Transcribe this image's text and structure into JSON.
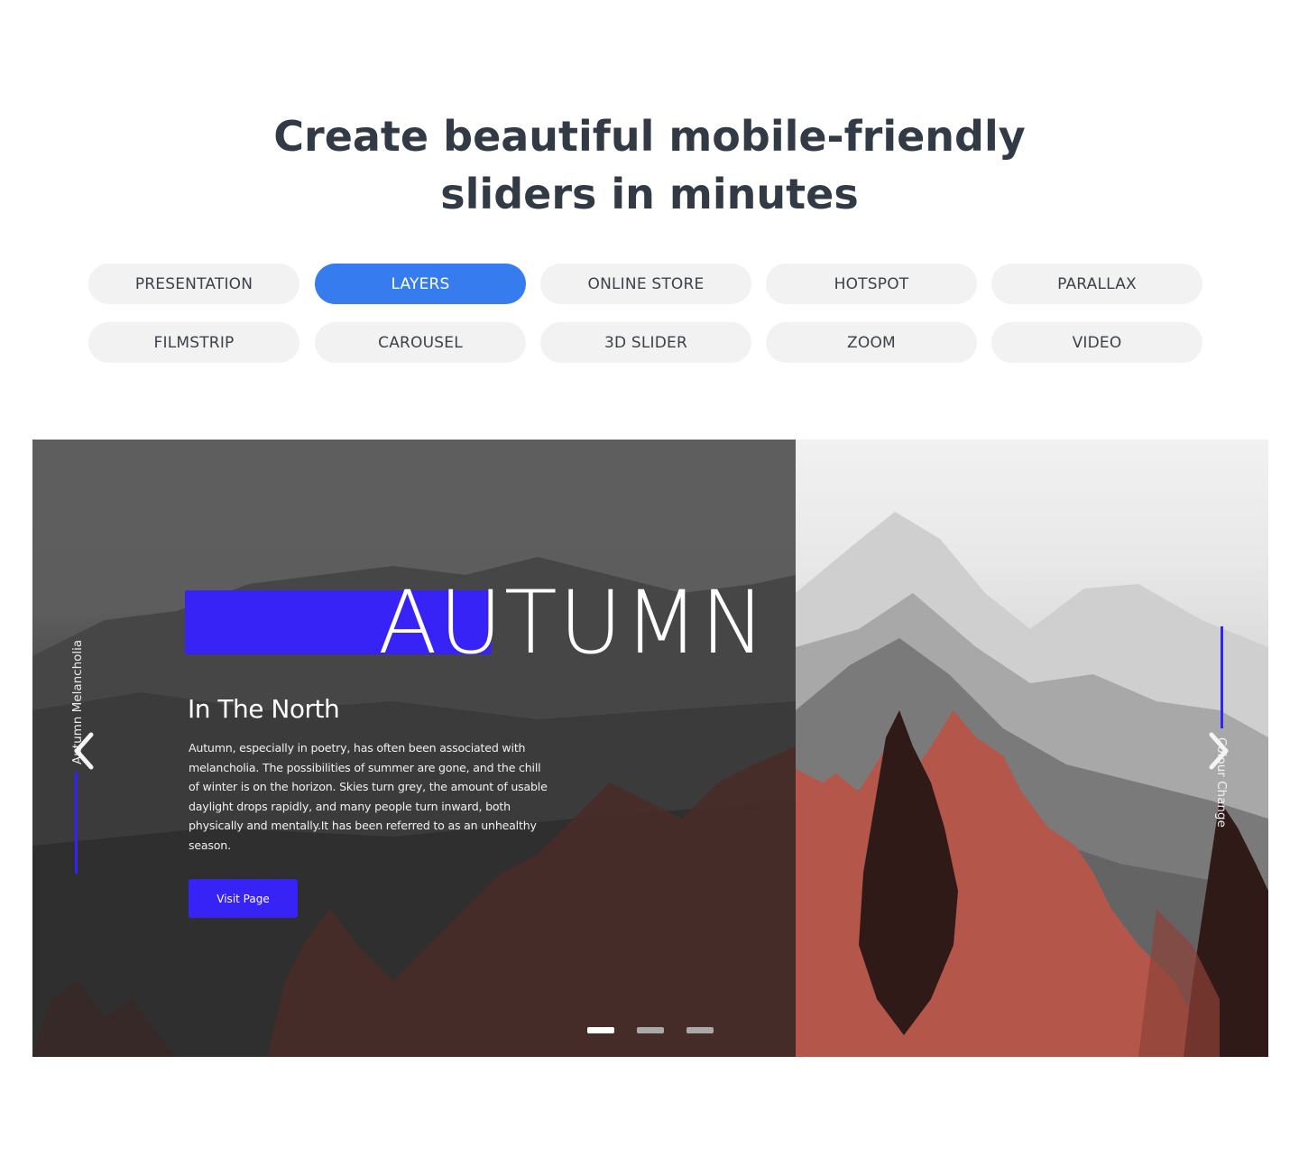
{
  "headline": {
    "line1": "Create beautiful mobile-friendly",
    "line2": "sliders in minutes"
  },
  "tabs": [
    {
      "label": "PRESENTATION",
      "active": false
    },
    {
      "label": "LAYERS",
      "active": true
    },
    {
      "label": "ONLINE STORE",
      "active": false
    },
    {
      "label": "HOTSPOT",
      "active": false
    },
    {
      "label": "PARALLAX",
      "active": false
    },
    {
      "label": "FILMSTRIP",
      "active": false
    },
    {
      "label": "CAROUSEL",
      "active": false
    },
    {
      "label": "3D SLIDER",
      "active": false
    },
    {
      "label": "ZOOM",
      "active": false
    },
    {
      "label": "VIDEO",
      "active": false
    }
  ],
  "slider": {
    "active_slide": {
      "title": "AUTUMN",
      "subtitle": "In The North",
      "body": "Autumn, especially in poetry, has often been associated with melancholia. The possibilities of summer are gone, and the chill of winter is on the horizon. Skies turn grey, the amount of usable daylight drops rapidly, and many people turn inward, both physically and mentally.It has been referred to as an unhealthy season.",
      "button_label": "Visit Page"
    },
    "prev_label": "Autumn Melancholia",
    "next_label": "Colour Change",
    "prev_icon": "chevron-left-icon",
    "next_icon": "chevron-right-icon",
    "pagination": {
      "count": 3,
      "current": 1
    }
  },
  "colors": {
    "accent_blue": "#367cee",
    "layer_blue": "#3823f7",
    "heading": "#323a45",
    "tab_bg": "#f2f2f2"
  }
}
